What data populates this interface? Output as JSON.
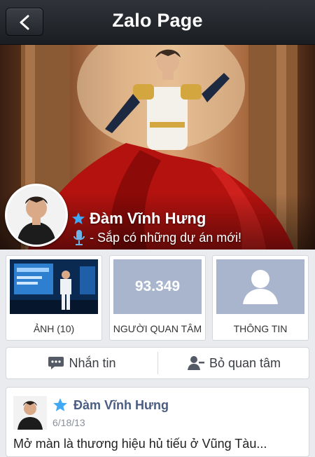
{
  "header": {
    "title": "Zalo Page",
    "back_icon": "chevron-left-icon"
  },
  "profile": {
    "name": "Đàm Vĩnh Hưng",
    "status": "- Sắp có những dự án mới!",
    "verified_icon": "star-icon",
    "status_icon": "microphone-icon"
  },
  "tiles": [
    {
      "label": "ẢNH (10)"
    },
    {
      "label": "NGƯỜI QUAN TÂM",
      "value": "93.349"
    },
    {
      "label": "THÔNG TIN",
      "icon": "person-silhouette-icon"
    }
  ],
  "actions": {
    "message_label": "Nhắn tin",
    "message_icon": "chat-bubble-icon",
    "unfollow_label": "Bỏ quan tâm",
    "unfollow_icon": "remove-user-icon"
  },
  "post": {
    "author": "Đàm Vĩnh Hưng",
    "date": "6/18/13",
    "text": "Mở màn là thương hiệu hủ tiếu ở Vũng Tàu..."
  },
  "colors": {
    "header_bg": "#1f2226",
    "tile_placeholder": "#a9b5cd",
    "verified_star": "#3fa9f5",
    "post_author": "#4b5d82"
  }
}
